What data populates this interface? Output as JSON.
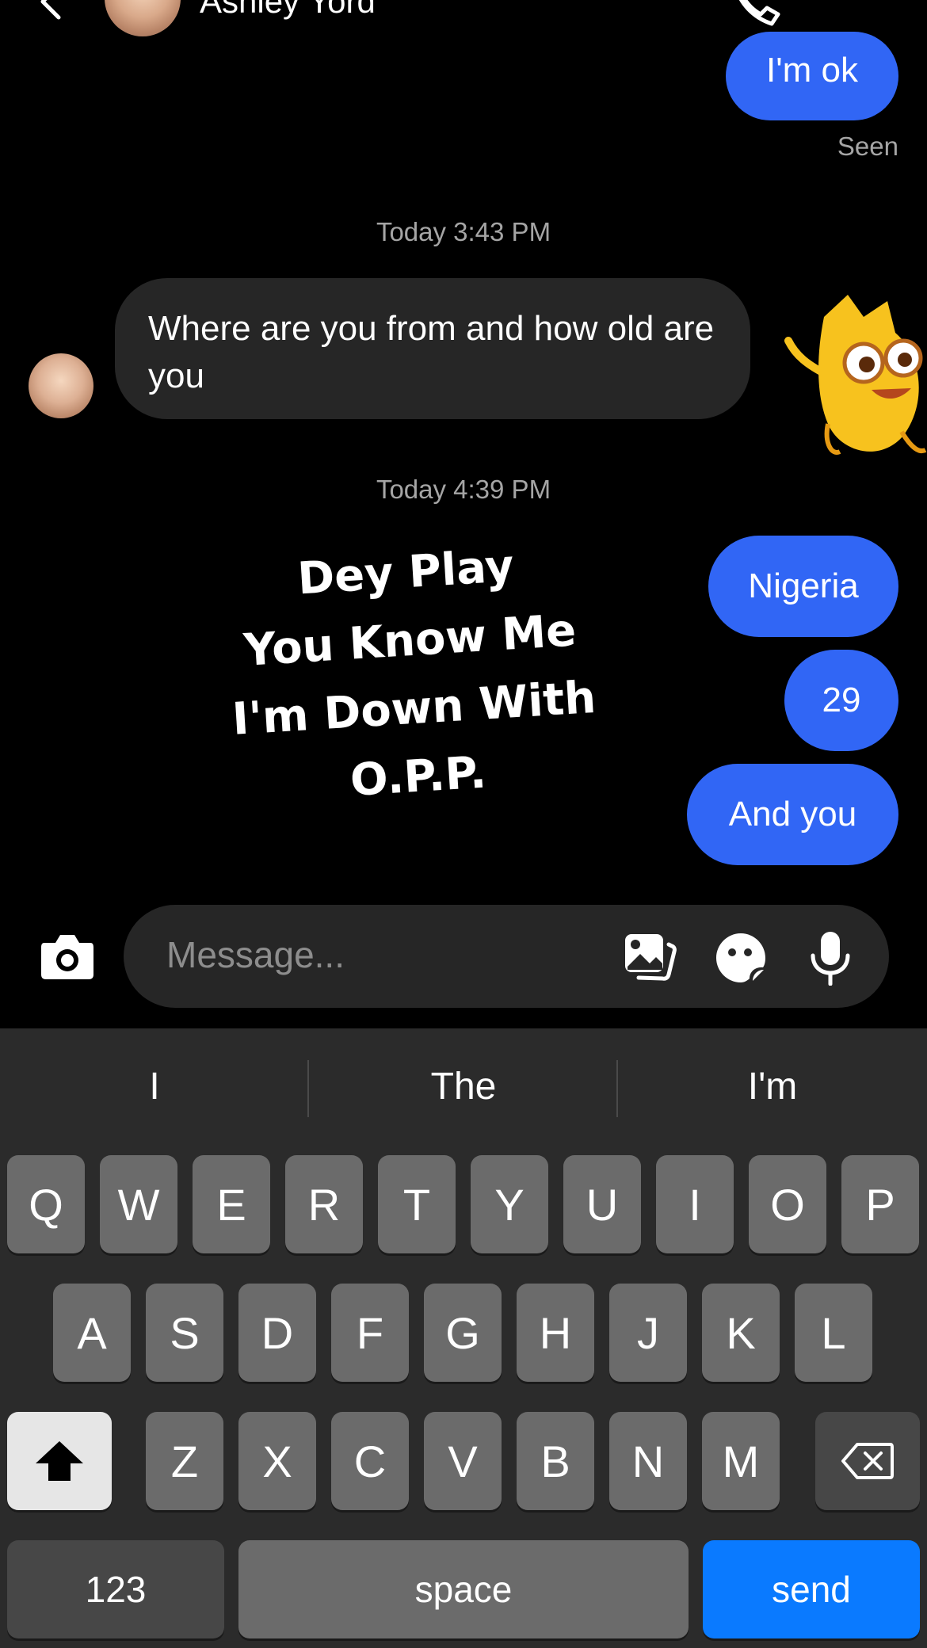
{
  "header": {
    "contact_name": "Ashley Yord"
  },
  "messages": {
    "im_ok": "I'm ok",
    "seen": "Seen",
    "timestamp_1": "Today 3:43 PM",
    "incoming_text": "Where are you from and how old are you",
    "timestamp_2": "Today 4:39 PM",
    "lyric_line_1": "Dey Play",
    "lyric_line_2": "You Know Me",
    "lyric_line_3": "I'm Down With O.P.P.",
    "outgoing": [
      "Nigeria",
      "29",
      "And you"
    ]
  },
  "composer": {
    "placeholder": "Message..."
  },
  "keyboard": {
    "suggestions": [
      "I",
      "The",
      "I'm"
    ],
    "row1": [
      "Q",
      "W",
      "E",
      "R",
      "T",
      "Y",
      "U",
      "I",
      "O",
      "P"
    ],
    "row2": [
      "A",
      "S",
      "D",
      "F",
      "G",
      "H",
      "J",
      "K",
      "L"
    ],
    "row3": [
      "Z",
      "X",
      "C",
      "V",
      "B",
      "N",
      "M"
    ],
    "numbers_label": "123",
    "space_label": "space",
    "send_label": "send"
  },
  "colors": {
    "outgoing_bubble": "#3166f5",
    "incoming_bubble": "#262626",
    "send_key": "#0a7aff",
    "keyboard_bg": "#2b2b2b"
  },
  "icons": [
    "back-icon",
    "call-icon",
    "more-icon",
    "camera-icon",
    "gallery-icon",
    "sticker-icon",
    "mic-icon",
    "shift-icon",
    "backspace-icon"
  ]
}
